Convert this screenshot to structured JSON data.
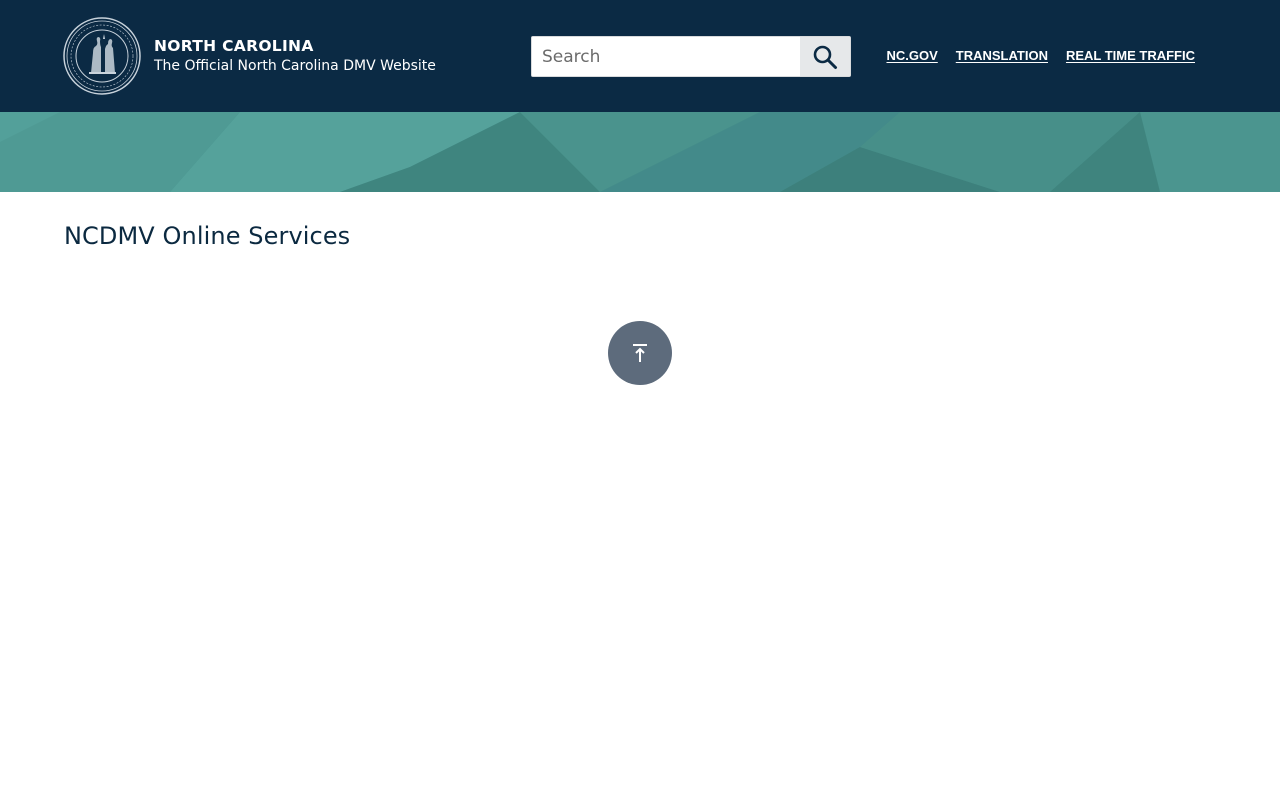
{
  "header": {
    "brand": {
      "seal_icon": "nc-state-seal-icon",
      "title": "NORTH CAROLINA",
      "subtitle": "The Official North Carolina DMV Website"
    },
    "search": {
      "placeholder": "Search",
      "value": "",
      "button_icon": "search-icon"
    },
    "links": [
      {
        "label": "NC.GOV"
      },
      {
        "label": "TRANSLATION"
      },
      {
        "label": "REAL TIME TRAFFIC"
      }
    ]
  },
  "banner": {
    "color": "#458e88"
  },
  "main": {
    "title": "NCDMV Online Services"
  },
  "back_to_top": {
    "icon": "arrow-up-to-line-icon"
  },
  "colors": {
    "header_bg": "#0b2a44",
    "banner_teal": "#458e88",
    "title_text": "#0b2940",
    "back_to_top_bg": "#5d6b7c"
  }
}
